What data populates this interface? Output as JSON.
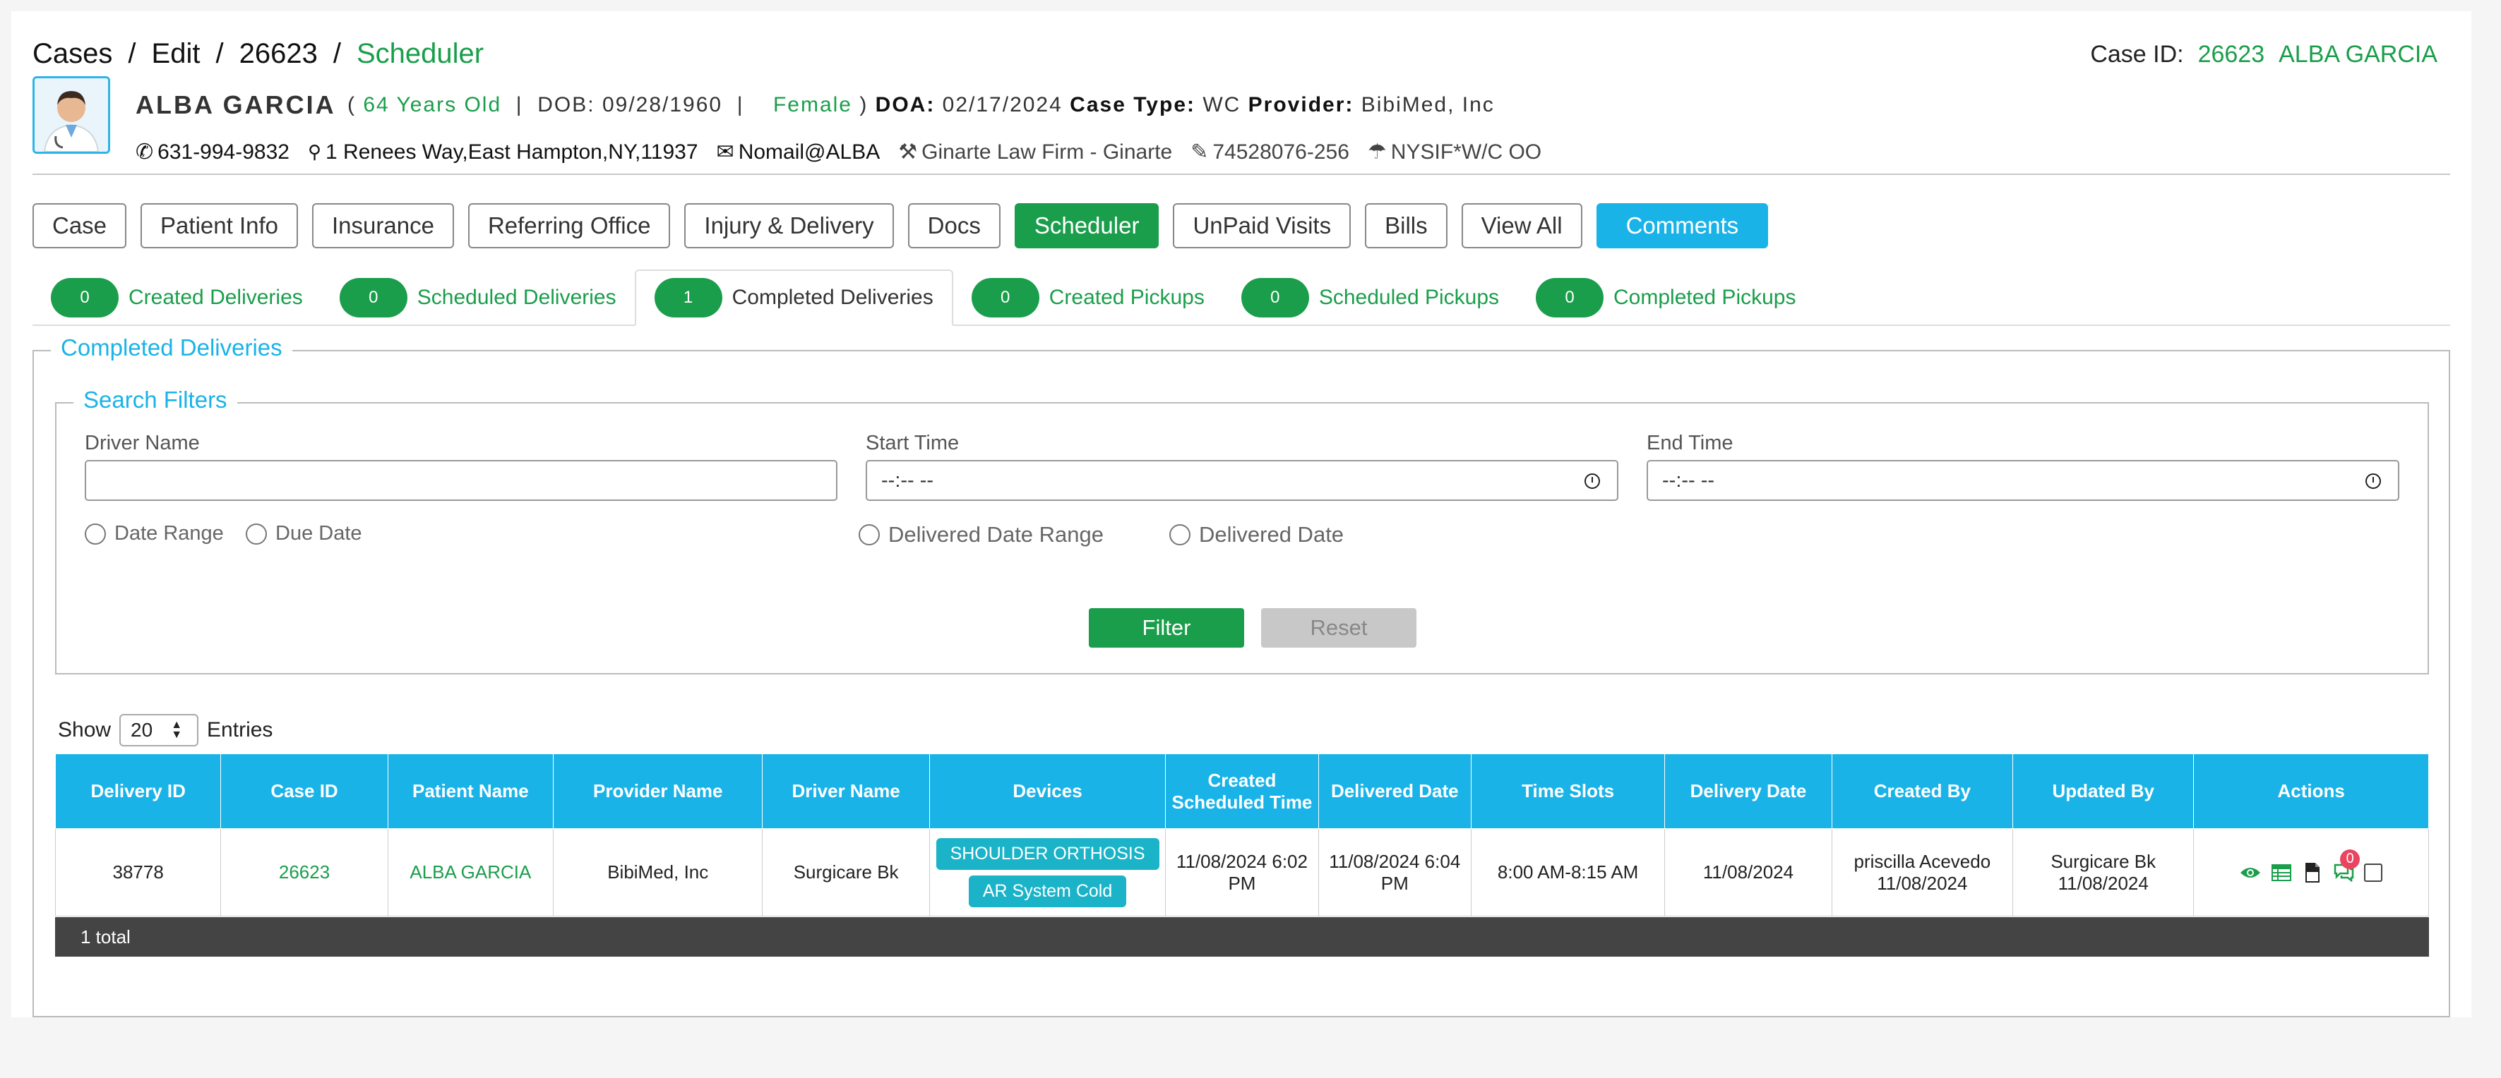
{
  "breadcrumb": {
    "cases": "Cases",
    "edit": "Edit",
    "id": "26623",
    "current": "Scheduler",
    "sep": "/"
  },
  "case_id": {
    "label": "Case ID:",
    "number": "26623",
    "name": "ALBA GARCIA"
  },
  "patient": {
    "name": "ALBA GARCIA",
    "age": "64 Years Old",
    "dob_label": "DOB:",
    "dob": "09/28/1960",
    "gender": "Female",
    "doa_label": "DOA:",
    "doa": "02/17/2024",
    "case_type_label": "Case Type:",
    "case_type": "WC",
    "provider_label": "Provider:",
    "provider": "BibiMed, Inc",
    "phone": "631-994-9832",
    "address": "1 Renees Way,East Hampton,NY,11937",
    "email": "Nomail@ALBA",
    "law_firm": "Ginarte Law Firm - Ginarte",
    "claim": "74528076-256",
    "insurance": "NYSIF*W/C OO"
  },
  "nav": [
    "Case",
    "Patient Info",
    "Insurance",
    "Referring Office",
    "Injury & Delivery",
    "Docs",
    "Scheduler",
    "UnPaid Visits",
    "Bills",
    "View All",
    "Comments"
  ],
  "tabs": [
    {
      "count": "0",
      "label": "Created Deliveries"
    },
    {
      "count": "0",
      "label": "Scheduled Deliveries"
    },
    {
      "count": "1",
      "label": "Completed Deliveries"
    },
    {
      "count": "0",
      "label": "Created Pickups"
    },
    {
      "count": "0",
      "label": "Scheduled Pickups"
    },
    {
      "count": "0",
      "label": "Completed Pickups"
    }
  ],
  "section_title": "Completed Deliveries",
  "filters": {
    "legend": "Search Filters",
    "driver_label": "Driver Name",
    "driver_value": "",
    "start_label": "Start Time",
    "start_value": "--:-- --",
    "end_label": "End Time",
    "end_value": "--:-- --",
    "radio_date_range": "Date Range",
    "radio_due_date": "Due Date",
    "radio_delivered_range": "Delivered Date Range",
    "radio_delivered_date": "Delivered Date",
    "filter_btn": "Filter",
    "reset_btn": "Reset"
  },
  "show": {
    "label": "Show",
    "value": "20",
    "suffix": "Entries"
  },
  "table": {
    "headers": [
      "Delivery ID",
      "Case ID",
      "Patient Name",
      "Provider Name",
      "Driver Name",
      "Devices",
      "Created Scheduled Time",
      "Delivered Date",
      "Time Slots",
      "Delivery Date",
      "Created By",
      "Updated By",
      "Actions"
    ],
    "row": {
      "delivery_id": "38778",
      "case_id": "26623",
      "patient": "ALBA GARCIA",
      "provider": "BibiMed, Inc",
      "driver": "Surgicare Bk",
      "device1": "SHOULDER ORTHOSIS",
      "device2": "AR System Cold",
      "created_time": "11/08/2024 6:02 PM",
      "delivered_date": "11/08/2024 6:04 PM",
      "time_slots": "8:00 AM-8:15 AM",
      "delivery_date": "11/08/2024",
      "created_by": "priscilla Acevedo",
      "created_by_date": "11/08/2024",
      "updated_by": "Surgicare Bk",
      "updated_by_date": "11/08/2024",
      "comment_badge": "0"
    },
    "total": "1 total"
  },
  "colors": {
    "green": "#1a9e4b",
    "blue": "#1ab3e8",
    "dark": "#444444"
  }
}
